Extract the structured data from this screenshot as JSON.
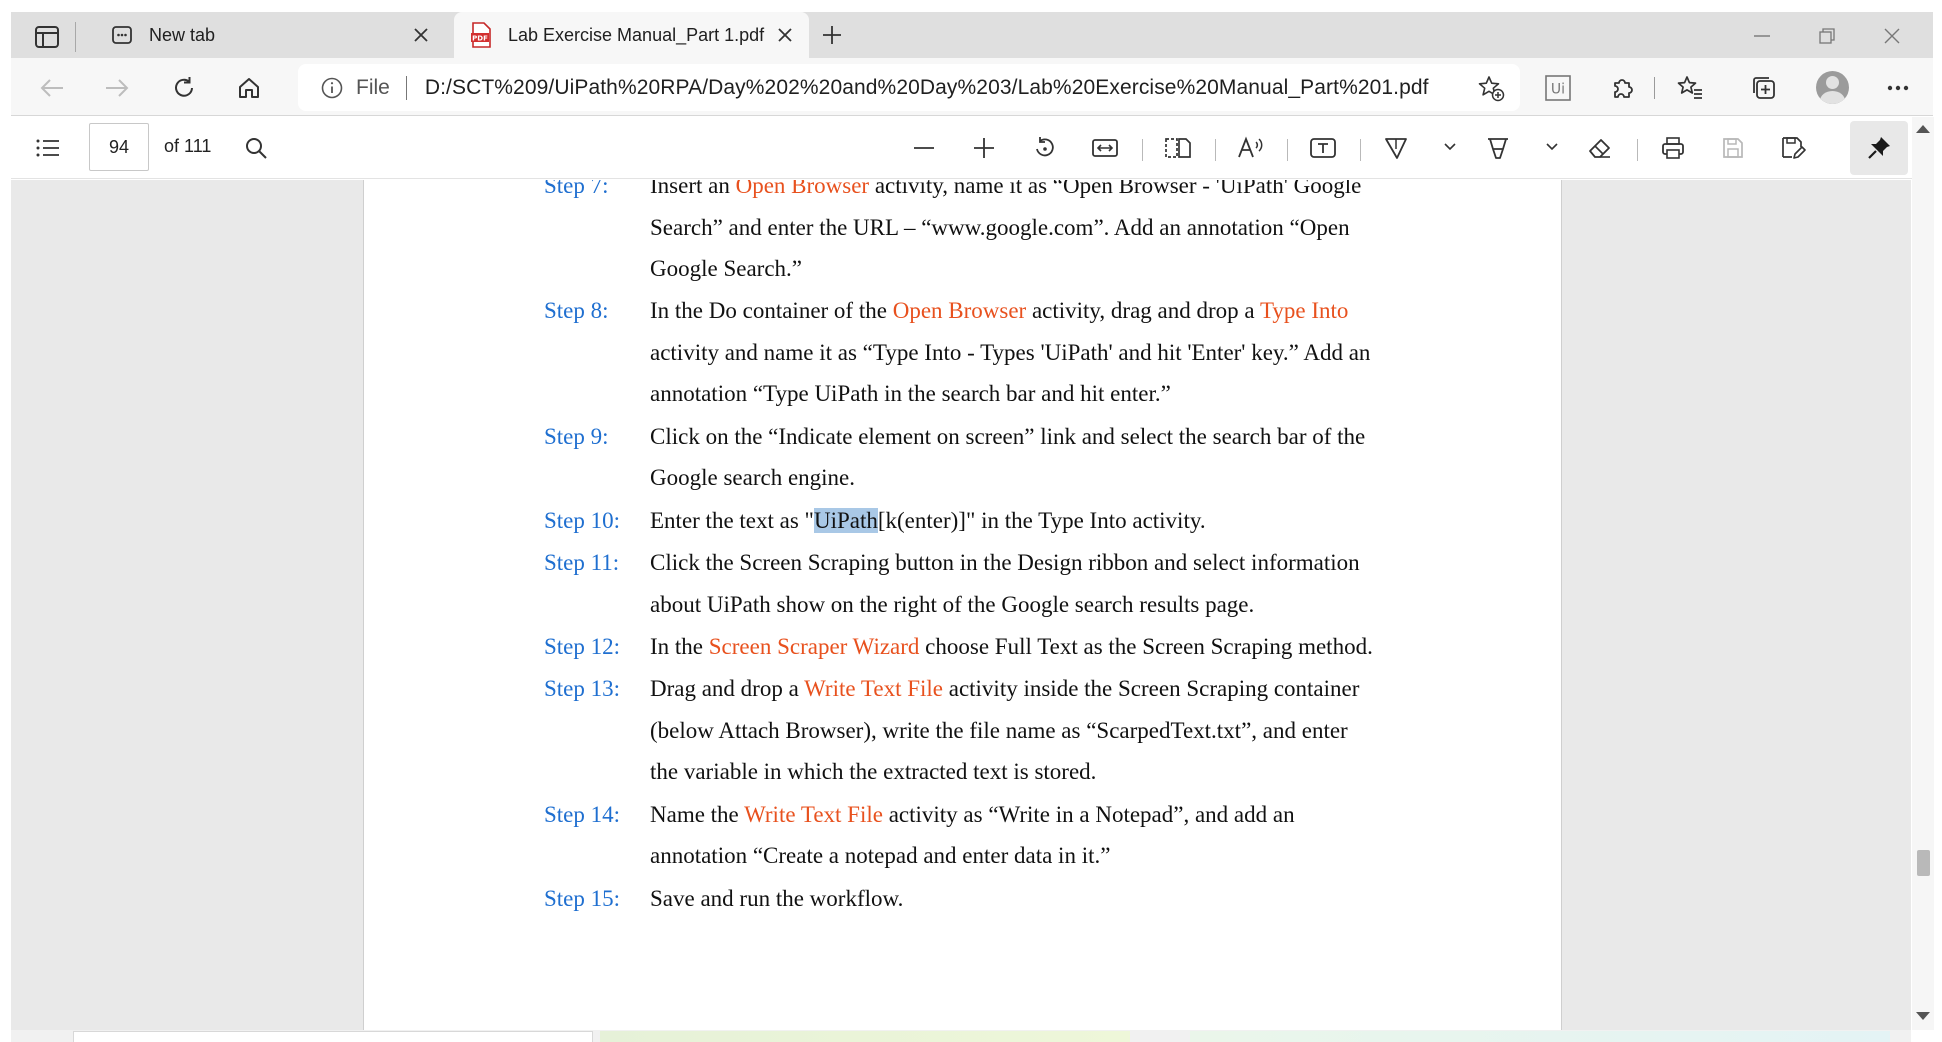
{
  "browser": {
    "tabs": [
      {
        "title": "New tab",
        "icon": "new-tab-page-icon",
        "active": false
      },
      {
        "title": "Lab Exercise Manual_Part 1.pdf",
        "icon": "pdf-file-icon",
        "active": true
      }
    ],
    "address": {
      "scheme_label": "File",
      "url": "D:/SCT%209/UiPath%20RPA/Day%202%20and%20Day%203/Lab%20Exercise%20Manual_Part%201.pdf"
    },
    "extension_label": "Ui"
  },
  "pdf_toolbar": {
    "current_page": "94",
    "total_pages": "of 111"
  },
  "steps": [
    {
      "label": "Step 7:",
      "lines": [
        [
          {
            "t": "Insert an "
          },
          {
            "t": "Open Browser",
            "hl": true
          },
          {
            "t": " activity, name it as “Open Browser - 'UiPath' Google"
          }
        ],
        [
          {
            "t": "Search” and enter the URL – “www.google.com”. Add an annotation “Open"
          }
        ],
        [
          {
            "t": "Google Search.”"
          }
        ]
      ]
    },
    {
      "label": "Step 8:",
      "lines": [
        [
          {
            "t": "In the Do container of the "
          },
          {
            "t": "Open Browser",
            "hl": true
          },
          {
            "t": " activity, drag and drop a "
          },
          {
            "t": "Type Into",
            "hl": true
          }
        ],
        [
          {
            "t": "activity and name it as “Type Into - Types 'UiPath' and hit 'Enter' key.” Add an"
          }
        ],
        [
          {
            "t": "annotation “Type UiPath in the search bar and hit enter.”"
          }
        ]
      ]
    },
    {
      "label": "Step 9:",
      "lines": [
        [
          {
            "t": "Click on the “Indicate element on screen” link and select the search bar of the"
          }
        ],
        [
          {
            "t": "Google search engine."
          }
        ]
      ]
    },
    {
      "label": "Step 10:",
      "lines": [
        [
          {
            "t": "Enter the text as \""
          },
          {
            "t": "UiPath",
            "sel": true
          },
          {
            "t": "[k(enter)]\" in the Type Into activity."
          }
        ]
      ]
    },
    {
      "label": "Step 11:",
      "lines": [
        [
          {
            "t": "Click the Screen Scraping button in the Design ribbon and select information"
          }
        ],
        [
          {
            "t": "about UiPath show on the right of the Google search results page."
          }
        ]
      ]
    },
    {
      "label": "Step 12:",
      "lines": [
        [
          {
            "t": "In the "
          },
          {
            "t": "Screen Scraper Wizard",
            "hl": true
          },
          {
            "t": " choose Full Text as the Screen Scraping method."
          }
        ]
      ]
    },
    {
      "label": "Step 13:",
      "lines": [
        [
          {
            "t": "Drag and drop a "
          },
          {
            "t": "Write Text File",
            "hl": true
          },
          {
            "t": " activity inside the Screen Scraping container"
          }
        ],
        [
          {
            "t": "(below Attach Browser), write the file name as “ScarpedText.txt”, and enter"
          }
        ],
        [
          {
            "t": "the variable in which the extracted text is stored."
          }
        ]
      ]
    },
    {
      "label": "Step 14:",
      "lines": [
        [
          {
            "t": "Name the "
          },
          {
            "t": "Write Text File",
            "hl": true
          },
          {
            "t": " activity as “Write in a Notepad”, and add an"
          }
        ],
        [
          {
            "t": "annotation “Create a notepad and enter data in it.”"
          }
        ]
      ]
    },
    {
      "label": "Step 15:",
      "lines": [
        [
          {
            "t": "Save and run the workflow."
          }
        ]
      ]
    }
  ],
  "colors": {
    "step_label": "#1f6fd0",
    "highlight_text": "#e8511e",
    "selection": "#a9c8e6",
    "page_background": "#e9e9e9"
  }
}
